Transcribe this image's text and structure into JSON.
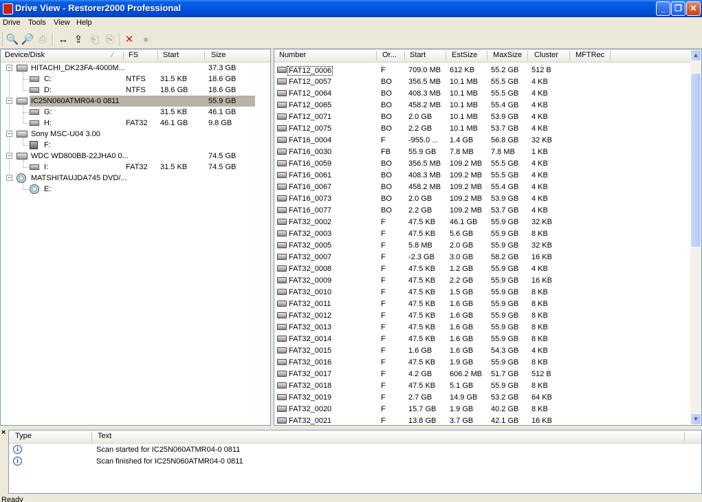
{
  "window": {
    "title": "Drive View - Restorer2000 Professional",
    "buttons": {
      "minimize": "_",
      "maximize": "❐",
      "close": "✕"
    }
  },
  "menu": [
    "Drive",
    "Tools",
    "View",
    "Help"
  ],
  "toolbar": {
    "buttons": [
      {
        "name": "open-drive-icon",
        "glyph": "🔍",
        "enabled": true
      },
      {
        "name": "scan-icon",
        "glyph": "🔎",
        "enabled": true
      },
      {
        "name": "recover-icon",
        "glyph": "⎙",
        "enabled": false
      },
      {
        "name": "resize-icon",
        "glyph": "↔",
        "enabled": true
      },
      {
        "name": "export-icon",
        "glyph": "⇪",
        "enabled": true
      },
      {
        "name": "copy-icon",
        "glyph": "⎗",
        "enabled": false
      },
      {
        "name": "paste-icon",
        "glyph": "⎘",
        "enabled": false
      },
      {
        "name": "delete-icon",
        "glyph": "✕",
        "enabled": true
      },
      {
        "name": "stop-icon",
        "glyph": "●",
        "enabled": false
      }
    ]
  },
  "device_tree": {
    "headers": {
      "device": "Device/Disk",
      "fs": "FS",
      "start": "Start",
      "size": "Size"
    },
    "rows": [
      {
        "name": "HITACHI_DK23FA-4000M...",
        "fs": "",
        "start": "",
        "size": "37.3 GB",
        "kind": "disk",
        "level": 0
      },
      {
        "name": "C:",
        "fs": "NTFS",
        "start": "31.5 KB",
        "size": "18.6 GB",
        "kind": "volume",
        "level": 1
      },
      {
        "name": "D:",
        "fs": "NTFS",
        "start": "18.6 GB",
        "size": "18.6 GB",
        "kind": "volume",
        "level": 1
      },
      {
        "name": "IC25N060ATMR04-0 0811",
        "fs": "",
        "start": "",
        "size": "55.9 GB",
        "kind": "disk",
        "level": 0,
        "selected": true
      },
      {
        "name": "G:",
        "fs": "",
        "start": "31.5 KB",
        "size": "46.1 GB",
        "kind": "volume",
        "level": 1
      },
      {
        "name": "H:",
        "fs": "FAT32",
        "start": "46.1 GB",
        "size": "9.8 GB",
        "kind": "volume",
        "level": 1
      },
      {
        "name": "Sony MSC-U04 3.00",
        "fs": "",
        "start": "",
        "size": "",
        "kind": "disk",
        "level": 0
      },
      {
        "name": "F:",
        "fs": "",
        "start": "",
        "size": "",
        "kind": "usb",
        "level": 1
      },
      {
        "name": "WDC WD800BB-22JHA0 0...",
        "fs": "",
        "start": "",
        "size": "74.5 GB",
        "kind": "disk",
        "level": 0
      },
      {
        "name": "I:",
        "fs": "FAT32",
        "start": "31.5 KB",
        "size": "74.5 GB",
        "kind": "volume",
        "level": 1
      },
      {
        "name": "MATSHITAUJDA745 DVD/...",
        "fs": "",
        "start": "",
        "size": "",
        "kind": "cd",
        "level": 0
      },
      {
        "name": "E:",
        "fs": "",
        "start": "",
        "size": "",
        "kind": "cd",
        "level": 1
      }
    ]
  },
  "found_list": {
    "headers": {
      "number": "Number",
      "origin": "Or...",
      "start": "Start",
      "estsize": "EstSize",
      "maxsize": "MaxSize",
      "cluster": "Cluster",
      "mftrec": "MFTRec"
    },
    "rows": [
      [
        "FAT12_0006",
        "F",
        "709.0 MB",
        "612 KB",
        "55.2 GB",
        "512 B"
      ],
      [
        "FAT12_0057",
        "BO",
        "356.5 MB",
        "10.1 MB",
        "55.5 GB",
        "4 KB"
      ],
      [
        "FAT12_0064",
        "BO",
        "408.3 MB",
        "10.1 MB",
        "55.5 GB",
        "4 KB"
      ],
      [
        "FAT12_0065",
        "BO",
        "458.2 MB",
        "10.1 MB",
        "55.4 GB",
        "4 KB"
      ],
      [
        "FAT12_0071",
        "BO",
        "2.0 GB",
        "10.1 MB",
        "53.9 GB",
        "4 KB"
      ],
      [
        "FAT12_0075",
        "BO",
        "2.2 GB",
        "10.1 MB",
        "53.7 GB",
        "4 KB"
      ],
      [
        "FAT16_0004",
        "F",
        "-955.0 ...",
        "1.4 GB",
        "56.8 GB",
        "32 KB"
      ],
      [
        "FAT16_0030",
        "FB",
        "55.9 GB",
        "7.8 MB",
        "7.8 MB",
        "1 KB"
      ],
      [
        "FAT16_0059",
        "BO",
        "356.5 MB",
        "109.2 MB",
        "55.5 GB",
        "4 KB"
      ],
      [
        "FAT16_0061",
        "BO",
        "408.3 MB",
        "109.2 MB",
        "55.5 GB",
        "4 KB"
      ],
      [
        "FAT16_0067",
        "BO",
        "458.2 MB",
        "109.2 MB",
        "55.4 GB",
        "4 KB"
      ],
      [
        "FAT16_0073",
        "BO",
        "2.0 GB",
        "109.2 MB",
        "53.9 GB",
        "4 KB"
      ],
      [
        "FAT16_0077",
        "BO",
        "2.2 GB",
        "109.2 MB",
        "53.7 GB",
        "4 KB"
      ],
      [
        "FAT32_0002",
        "F",
        "47.5 KB",
        "46.1 GB",
        "55.9 GB",
        "32 KB"
      ],
      [
        "FAT32_0003",
        "F",
        "47.5 KB",
        "5.6 GB",
        "55.9 GB",
        "8 KB"
      ],
      [
        "FAT32_0005",
        "F",
        "5.8 MB",
        "2.0 GB",
        "55.9 GB",
        "32 KB"
      ],
      [
        "FAT32_0007",
        "F",
        "-2.3 GB",
        "3.0 GB",
        "58.2 GB",
        "16 KB"
      ],
      [
        "FAT32_0008",
        "F",
        "47.5 KB",
        "1.2 GB",
        "55.9 GB",
        "4 KB"
      ],
      [
        "FAT32_0009",
        "F",
        "47.5 KB",
        "2.2 GB",
        "55.9 GB",
        "16 KB"
      ],
      [
        "FAT32_0010",
        "F",
        "47.5 KB",
        "1.5 GB",
        "55.9 GB",
        "8 KB"
      ],
      [
        "FAT32_0011",
        "F",
        "47.5 KB",
        "1.6 GB",
        "55.9 GB",
        "8 KB"
      ],
      [
        "FAT32_0012",
        "F",
        "47.5 KB",
        "1.6 GB",
        "55.9 GB",
        "8 KB"
      ],
      [
        "FAT32_0013",
        "F",
        "47.5 KB",
        "1.6 GB",
        "55.9 GB",
        "8 KB"
      ],
      [
        "FAT32_0014",
        "F",
        "47.5 KB",
        "1.6 GB",
        "55.9 GB",
        "8 KB"
      ],
      [
        "FAT32_0015",
        "F",
        "1.6 GB",
        "1.6 GB",
        "54.3 GB",
        "4 KB"
      ],
      [
        "FAT32_0016",
        "F",
        "47.5 KB",
        "1.9 GB",
        "55.9 GB",
        "8 KB"
      ],
      [
        "FAT32_0017",
        "F",
        "4.2 GB",
        "606.2 MB",
        "51.7 GB",
        "512 B"
      ],
      [
        "FAT32_0018",
        "F",
        "47.5 KB",
        "5.1 GB",
        "55.9 GB",
        "8 KB"
      ],
      [
        "FAT32_0019",
        "F",
        "2.7 GB",
        "14.9 GB",
        "53.2 GB",
        "64 KB"
      ],
      [
        "FAT32_0020",
        "F",
        "15.7 GB",
        "1.9 GB",
        "40.2 GB",
        "8 KB"
      ],
      [
        "FAT32_0021",
        "F",
        "13.8 GB",
        "3.7 GB",
        "42.1 GB",
        "16 KB"
      ]
    ],
    "selected_index": 0,
    "scroll": {
      "up": "▲",
      "down": "▼"
    }
  },
  "log": {
    "close": "×",
    "headers": {
      "type": "Type",
      "text": "Text"
    },
    "rows": [
      {
        "icon": "info-icon",
        "glyph": "i",
        "text": "Scan started for IC25N060ATMR04-0 0811"
      },
      {
        "icon": "info-icon",
        "glyph": "i",
        "text": "Scan finished for IC25N060ATMR04-0 0811"
      }
    ]
  },
  "status": {
    "text": "Ready"
  }
}
